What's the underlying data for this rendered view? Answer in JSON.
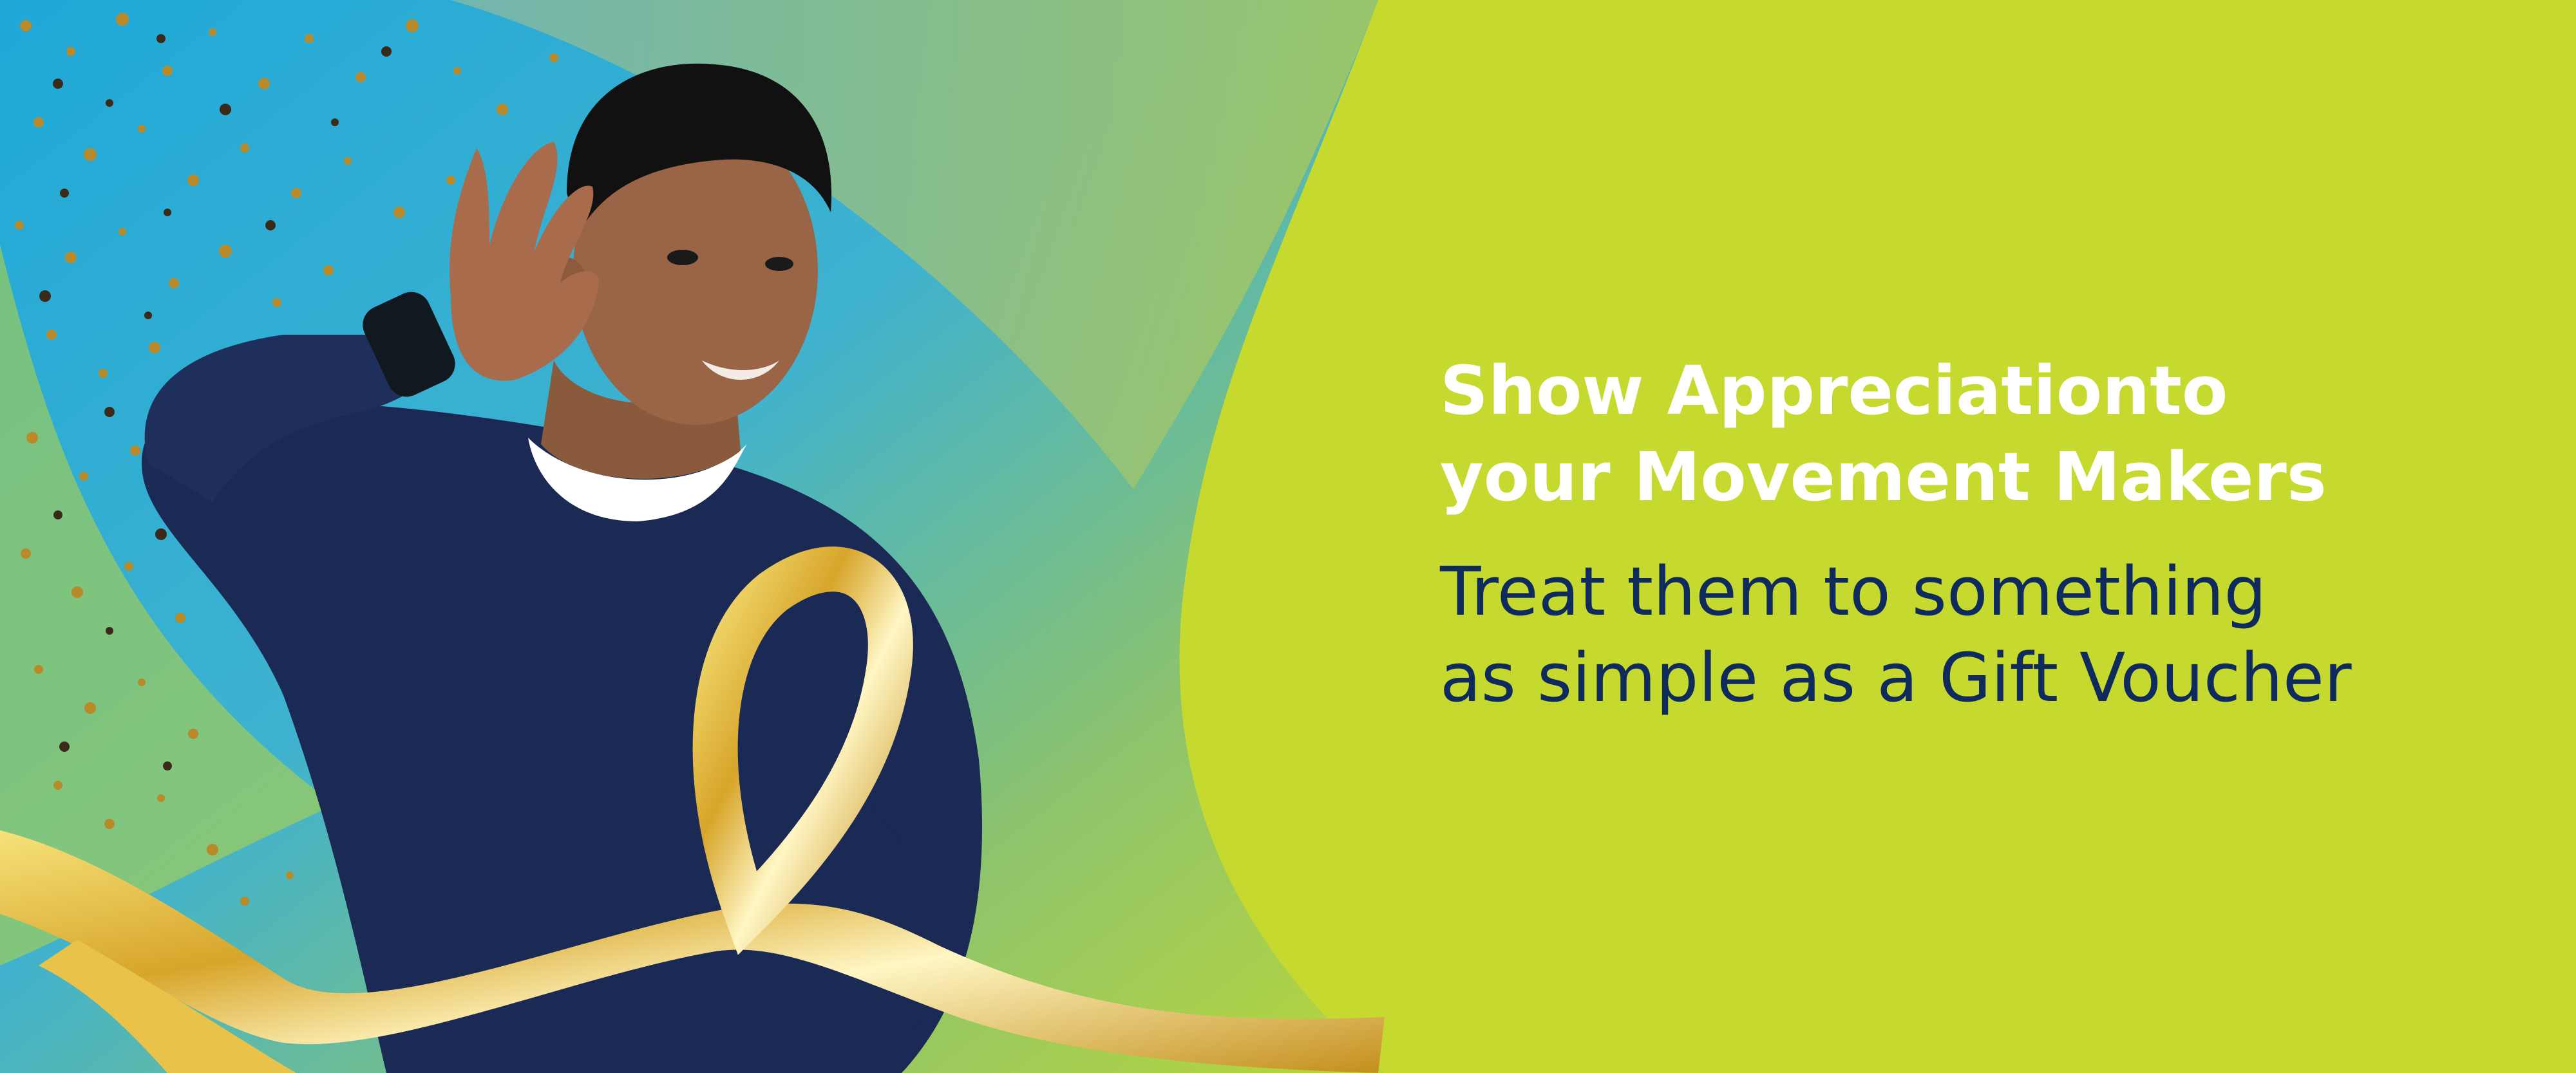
{
  "banner": {
    "headline": [
      "Show Appreciationto",
      "your Movement Makers"
    ],
    "subline": [
      "Treat them to something",
      "as simple as a Gift Voucher"
    ]
  },
  "colors": {
    "background": "#c5d92f",
    "headline": "#ffffff",
    "subline": "#0f2a5c",
    "gradient_blue": "#22a9d6",
    "gradient_green": "#7fbf6a",
    "ribbon_gold": "#d9a826",
    "sweater_navy": "#1b2a55"
  },
  "image": {
    "subject": "young man cupping hand behind ear, wearing navy sweater",
    "decorations": [
      "gold confetti",
      "gold ribbon"
    ]
  }
}
